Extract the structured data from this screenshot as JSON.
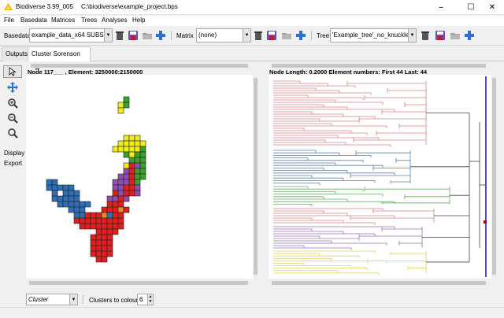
{
  "window": {
    "app_title": "Biodiverse 3.99_005",
    "file_path": "C:\\biodiverse\\example_project.bps",
    "minimize": "–",
    "maximize": "☐",
    "close": "✕"
  },
  "menu": {
    "items": [
      "File",
      "Basedata",
      "Matrices",
      "Trees",
      "Analyses",
      "Help"
    ]
  },
  "toolbar": {
    "basedata_label": "Basedata",
    "basedata_value": "example_data_x64 SUBSET",
    "matrix_label": "Matrix",
    "matrix_value": "(none)",
    "tree_label": "Tree",
    "tree_value": "'Example_tree'_no_knuckles",
    "icons": [
      "delete-icon",
      "save-icon",
      "open-folder-icon",
      "add-icon"
    ]
  },
  "tabs": {
    "outputs": "Outputs",
    "cluster": "Cluster Sorenson",
    "close_glyph": "✖"
  },
  "tools": {
    "display_label": "Display",
    "export_label": "Export",
    "icons": [
      "select-arrow-icon",
      "pan-icon",
      "zoom-in-icon",
      "zoom-out-icon",
      "zoom-fit-icon"
    ]
  },
  "map": {
    "node_info": "Node 117___ , Element: 3250000:2150000"
  },
  "tree": {
    "info": "Node Length:  0.2000 Element numbers: First 44 Last: 44"
  },
  "bottom": {
    "cluster_select": "Cluster",
    "clusters_to_colour_label": "Clusters to colour",
    "clusters_to_colour_value": "6"
  },
  "colors": {
    "red": "#e02020",
    "blue": "#2f6fb5",
    "purple": "#8e4fb0",
    "green": "#3aa02f",
    "yellow": "#f2ee1e",
    "orange": "#f08a20",
    "tree_red": "#d98080",
    "tree_blue": "#5f7f9f",
    "tree_green": "#6aaa6a",
    "tree_purple": "#9a70b8",
    "tree_yellow": "#e0d060",
    "tree_selected": "#3020c0"
  }
}
